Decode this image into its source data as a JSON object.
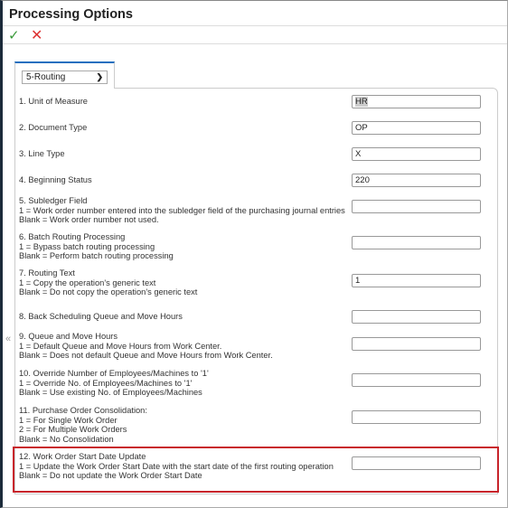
{
  "title": "Processing Options",
  "toolbar": {
    "ok_icon": "checkmark-icon",
    "cancel_icon": "x-icon"
  },
  "tab": {
    "selected": "5-Routing"
  },
  "options": [
    {
      "lines": [
        "1. Unit of Measure"
      ],
      "value": "HR"
    },
    {
      "lines": [
        "2. Document Type"
      ],
      "value": "OP"
    },
    {
      "lines": [
        "3. Line Type"
      ],
      "value": "X"
    },
    {
      "lines": [
        "4. Beginning Status"
      ],
      "value": "220"
    },
    {
      "lines": [
        "5. Subledger Field",
        "1 = Work order number entered into the subledger field of the purchasing journal entries",
        "Blank = Work order number not used."
      ],
      "value": ""
    },
    {
      "lines": [
        "6. Batch Routing Processing",
        "1 = Bypass batch routing processing",
        "Blank = Perform batch routing processing"
      ],
      "value": ""
    },
    {
      "lines": [
        "7. Routing Text",
        "1 = Copy the operation's generic text",
        "Blank = Do not copy the operation's generic text"
      ],
      "value": "1"
    },
    {
      "lines": [
        "8. Back Scheduling Queue and Move Hours"
      ],
      "value": ""
    },
    {
      "lines": [
        "9. Queue and Move Hours",
        "1 = Default Queue and Move Hours from Work Center.",
        "Blank = Does not default Queue and Move Hours from Work Center."
      ],
      "value": ""
    },
    {
      "lines": [
        "10. Override Number of Employees/Machines to '1'",
        "1 = Override No. of Employees/Machines to '1'",
        "Blank = Use existing No. of Employees/Machines"
      ],
      "value": ""
    },
    {
      "lines": [
        "11. Purchase Order Consolidation:",
        "1 = For Single Work Order",
        "2 = For Multiple Work Orders",
        "Blank = No Consolidation"
      ],
      "value": ""
    },
    {
      "lines": [
        "12. Work Order Start Date Update",
        "1 = Update the Work Order Start Date with the start date of the first routing operation",
        "Blank = Do not update the Work Order Start Date"
      ],
      "value": ""
    }
  ]
}
